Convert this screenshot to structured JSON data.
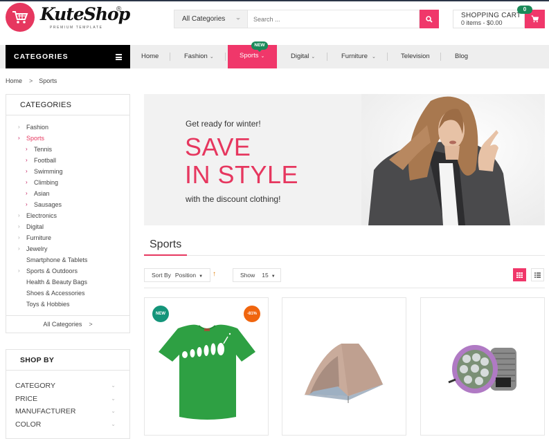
{
  "header": {
    "logo_text": "KuteShop",
    "logo_reg": "®",
    "logo_tagline": "PREMIUM TEMPLATE",
    "search": {
      "category_selected": "All Categories",
      "placeholder": "Search ..."
    },
    "cart": {
      "title": "SHOPPING CART",
      "summary": "0 items - $0.00",
      "count": "0"
    }
  },
  "nav": {
    "categories_label": "CATEGORIES",
    "items": [
      {
        "label": "Home",
        "has_dropdown": false
      },
      {
        "label": "Fashion",
        "has_dropdown": true
      },
      {
        "label": "Sports",
        "has_dropdown": true,
        "active": true,
        "badge": "NEW"
      },
      {
        "label": "Digital",
        "has_dropdown": true
      },
      {
        "label": "Furniture",
        "has_dropdown": true
      },
      {
        "label": "Television",
        "has_dropdown": false
      },
      {
        "label": "Blog",
        "has_dropdown": false
      }
    ],
    "chevron": "⌄"
  },
  "breadcrumb": {
    "items": [
      "Home",
      "Sports"
    ],
    "separator": ">"
  },
  "sidebar": {
    "categories": {
      "title": "CATEGORIES",
      "items": [
        {
          "label": "Fashion",
          "level": 0,
          "arrow": true
        },
        {
          "label": "Sports",
          "level": 0,
          "arrow": true,
          "active": true
        },
        {
          "label": "Tennis",
          "level": 1,
          "arrow": true
        },
        {
          "label": "Football",
          "level": 1,
          "arrow": true
        },
        {
          "label": "Swimming",
          "level": 1,
          "arrow": true
        },
        {
          "label": "Climbing",
          "level": 1,
          "arrow": true
        },
        {
          "label": "Asian",
          "level": 1,
          "arrow": true
        },
        {
          "label": "Sausages",
          "level": 1,
          "arrow": true
        },
        {
          "label": "Electronics",
          "level": 0,
          "arrow": true
        },
        {
          "label": "Digital",
          "level": 0,
          "arrow": true
        },
        {
          "label": "Furniture",
          "level": 0,
          "arrow": true
        },
        {
          "label": "Jewelry",
          "level": 0,
          "arrow": true
        },
        {
          "label": "Smartphone & Tablets",
          "level": 0,
          "arrow": false
        },
        {
          "label": "Sports & Outdoors",
          "level": 0,
          "arrow": true
        },
        {
          "label": "Health & Beauty Bags",
          "level": 0,
          "arrow": false
        },
        {
          "label": "Shoes & Accessories",
          "level": 0,
          "arrow": false
        },
        {
          "label": "Toys & Hobbies",
          "level": 0,
          "arrow": false
        }
      ],
      "all_label": "All Categories",
      "all_arrow": ">"
    },
    "shop_by": {
      "title": "SHOP BY",
      "filters": [
        "CATEGORY",
        "PRICE",
        "MANUFACTURER",
        "COLOR"
      ]
    }
  },
  "banner": {
    "pre": "Get ready for winter!",
    "line1": "SAVE",
    "line2": "IN STYLE",
    "post": "with the discount clothing!"
  },
  "section": {
    "title": "Sports"
  },
  "toolbar": {
    "sort_label": "Sort By",
    "sort_value": "Position",
    "sort_direction": "↑",
    "show_label": "Show",
    "show_value": "15",
    "view_mode": "grid"
  },
  "products": [
    {
      "image": "green-tshirt",
      "badge_new": "NEW",
      "badge_sale": "-81%"
    },
    {
      "image": "dome-tent"
    },
    {
      "image": "bike-light"
    }
  ],
  "colors": {
    "accent": "#f0376a",
    "new_badge": "#1b8a5a",
    "sale_badge": "#f0650e",
    "nav_bg": "#eeeeee",
    "category_bar": "#000000"
  }
}
